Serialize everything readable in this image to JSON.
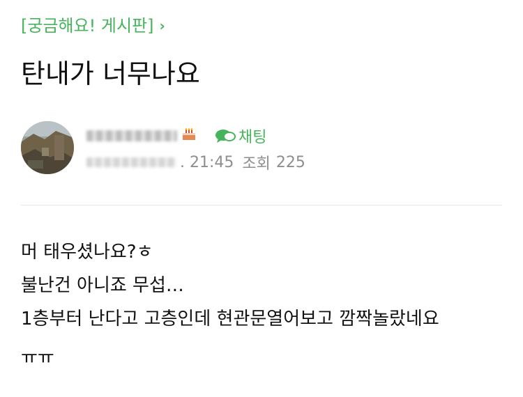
{
  "board": {
    "label": "[궁금해요! 게시판]",
    "chevron": "›"
  },
  "post": {
    "title": "탄내가 너무나요",
    "body": [
      "머 태우셨나요?ㅎ",
      "불난건 아니죠 무섭…",
      "1층부터 난다고 고층인데 현관문열어보고 깜짝놀랐네요",
      "ㅠㅠ"
    ]
  },
  "author": {
    "badge_icon": "cake-icon",
    "chat_label": "채팅",
    "chat_icon": "chat-bubble-icon",
    "time": ". 21:45",
    "views_label": "조회",
    "views_count": "225"
  },
  "colors": {
    "accent": "#47b45c",
    "meta": "#8e8e8e",
    "text": "#111111",
    "divider": "#e6e6e6"
  }
}
